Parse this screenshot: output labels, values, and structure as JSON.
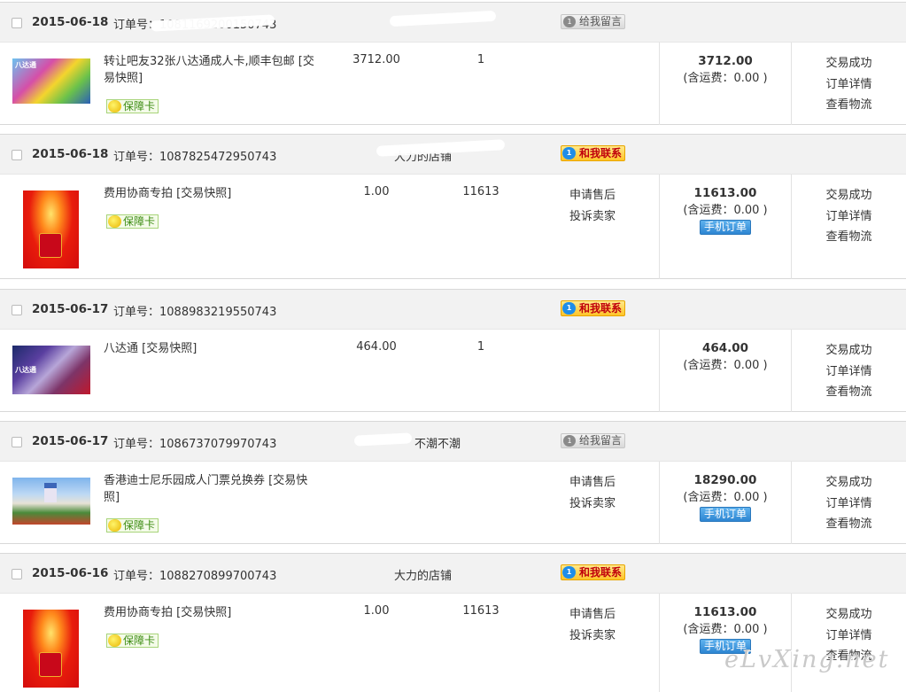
{
  "orders": [
    {
      "date": "2015-06-18",
      "order_label": "订单号：",
      "order_no": "1081169200150743",
      "shop": "",
      "action": "给我留言",
      "item_title": "转让吧友32张八达通成人卡,顺丰包邮 [交易快照]",
      "guarantee": "保障卡",
      "price": "3712.00",
      "qty": "1",
      "after_sales": [
        "",
        ""
      ],
      "total": "3712.00",
      "shipping": "(含运费：0.00 )",
      "mobile": "",
      "status": [
        "交易成功",
        "订单详情",
        "查看物流"
      ]
    },
    {
      "date": "2015-06-18",
      "order_label": "订单号：",
      "order_no": "1087825472950743",
      "shop": "大力的店铺",
      "action": "和我联系",
      "item_title": "费用协商专拍 [交易快照]",
      "guarantee": "保障卡",
      "price": "1.00",
      "qty": "11613",
      "after_sales": [
        "申请售后",
        "投诉卖家"
      ],
      "total": "11613.00",
      "shipping": "(含运费：0.00 )",
      "mobile": "手机订单",
      "status": [
        "交易成功",
        "订单详情",
        "查看物流"
      ]
    },
    {
      "date": "2015-06-17",
      "order_label": "订单号：",
      "order_no": "1088983219550743",
      "shop": "",
      "action": "和我联系",
      "item_title": "八达通 [交易快照]",
      "guarantee": "",
      "price": "464.00",
      "qty": "1",
      "after_sales": [
        "",
        ""
      ],
      "total": "464.00",
      "shipping": "(含运费：0.00 )",
      "mobile": "",
      "status": [
        "交易成功",
        "订单详情",
        "查看物流"
      ]
    },
    {
      "date": "2015-06-17",
      "order_label": "订单号：",
      "order_no": "1086737079970743",
      "shop": "不潮不潮",
      "action": "给我留言",
      "item_title": "香港迪士尼乐园成人门票兑换券 [交易快照]",
      "guarantee": "保障卡",
      "price": "",
      "qty": "",
      "after_sales": [
        "申请售后",
        "投诉卖家"
      ],
      "total": "18290.00",
      "shipping": "(含运费：0.00 )",
      "mobile": "手机订单",
      "status": [
        "交易成功",
        "订单详情",
        "查看物流"
      ]
    },
    {
      "date": "2015-06-16",
      "order_label": "订单号：",
      "order_no": "1088270899700743",
      "shop": "大力的店铺",
      "action": "和我联系",
      "item_title": "费用协商专拍 [交易快照]",
      "guarantee": "保障卡",
      "price": "1.00",
      "qty": "11613",
      "after_sales": [
        "申请售后",
        "投诉卖家"
      ],
      "total": "11613.00",
      "shipping": "(含运费：0.00 )",
      "mobile": "手机订单",
      "status": [
        "交易成功",
        "订单详情",
        "查看物流"
      ]
    }
  ],
  "bubble_count": "1",
  "watermark": "eLvXing.net"
}
